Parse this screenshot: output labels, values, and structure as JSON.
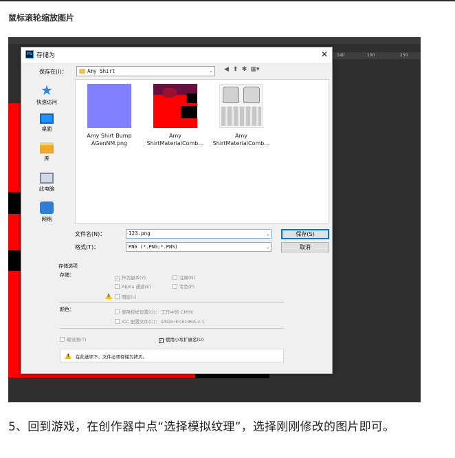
{
  "article": {
    "heading": "鼠标滚轮缩放图片",
    "caption": "5、回到游戏，在创作器中点“选择模拟纹理”，选择刚刚修改的图片即可。"
  },
  "photoshop": {
    "ruler_ticks": [
      "140",
      "190",
      "250"
    ]
  },
  "dialog": {
    "app_icon": "photoshop-icon",
    "title": "存储为",
    "close_glyph": "✕",
    "save_in_label": "保存在(I)：",
    "location": "Amy Shirt",
    "nav_icons": [
      "back-icon",
      "up-folder-icon",
      "new-folder-icon",
      "view-menu-icon"
    ],
    "nav_glyphs": [
      "◀",
      "⬆",
      "✱",
      "▦▾"
    ],
    "places": [
      {
        "label": "快速访问",
        "icon": "star-icon"
      },
      {
        "label": "桌面",
        "icon": "desktop-icon"
      },
      {
        "label": "库",
        "icon": "library-icon"
      },
      {
        "label": "此电脑",
        "icon": "computer-icon"
      },
      {
        "label": "网络",
        "icon": "network-icon"
      }
    ],
    "files": [
      {
        "name_line1": "Amy Shirt Bump",
        "name_line2": "AGenNM.png"
      },
      {
        "name_line1": "Amy",
        "name_line2": "ShirtMaterialComb…"
      },
      {
        "name_line1": "Amy",
        "name_line2": "ShirtMaterialComb…"
      }
    ],
    "filename_label": "文件名(N)：",
    "filename_value": "123.png",
    "format_label": "格式(T)：",
    "format_value": "PNG (*.PNG;*.PNS)",
    "save_button": "保存(S)",
    "cancel_button": "取消",
    "options": {
      "section_title": "存储选项",
      "store_label": "存储：",
      "as_copy": "作为副本(Y)",
      "notes": "注释(N)",
      "alpha": "Alpha 通道(E)",
      "spot": "专色(P)",
      "layers": "图层(L)",
      "color_label": "颜色：",
      "use_proof": "使用校样设置(O)：",
      "proof_value": "工作中的 CMYK",
      "icc": "ICC 配置文件(C)：",
      "icc_value": "sRGB IEC61966-2.1",
      "thumbnail": "缩览图(T)",
      "lowercase_ext": "使用小写扩展名(U)",
      "warning": "在此选项下，文件必须存储为拷贝。"
    }
  }
}
